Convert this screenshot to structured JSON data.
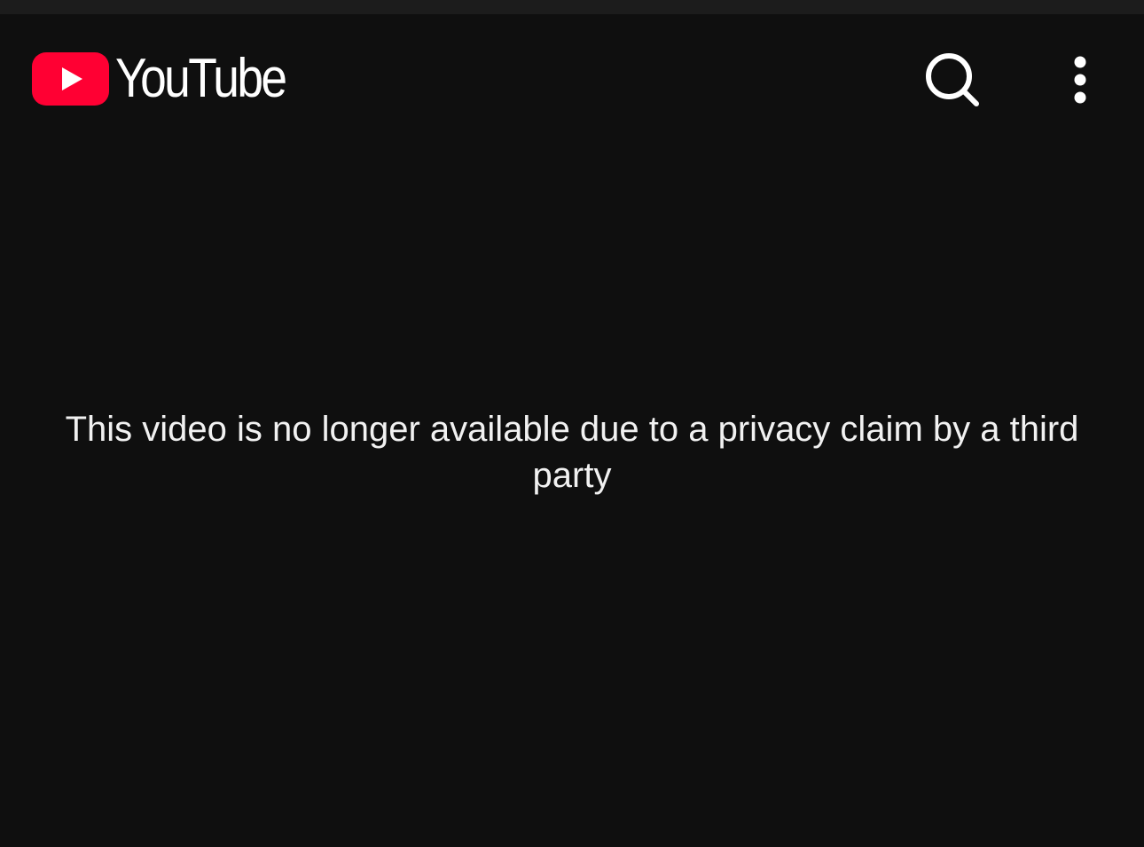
{
  "header": {
    "logo_text": "YouTube",
    "brand_color": "#ff0033",
    "icons": {
      "logo": "youtube-play-logo-icon",
      "search": "search-icon",
      "more": "more-vert-icon"
    }
  },
  "main": {
    "message": "This video is no longer available due to a privacy claim by a third party"
  }
}
